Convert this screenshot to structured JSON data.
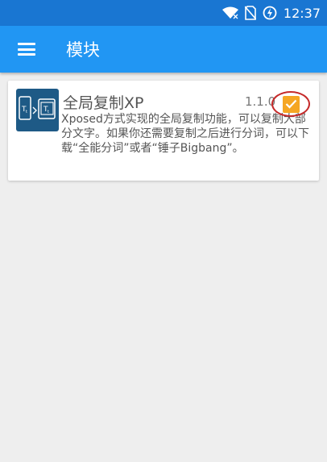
{
  "status_bar": {
    "time": "12:37",
    "icons": [
      "wifi-icon",
      "no-sim-icon",
      "battery-charging-icon"
    ]
  },
  "app_bar": {
    "title": "模块",
    "menu_icon": "menu-icon"
  },
  "modules": [
    {
      "name": "全局复制XP",
      "version": "1.1.0",
      "description": "Xposed方式实现的全局复制功能，可以复制大部分文字。如果你还需要复制之后进行分词，可以下载“全能分词”或者“锤子Bigbang”。",
      "enabled": true
    }
  ],
  "colors": {
    "status_bar": "#1976d2",
    "app_bar": "#2196f3",
    "background": "#eeeeee",
    "checkbox": "#f5a623",
    "annotation_circle": "#c52a2a",
    "module_icon_bg": "#1e5a86"
  }
}
